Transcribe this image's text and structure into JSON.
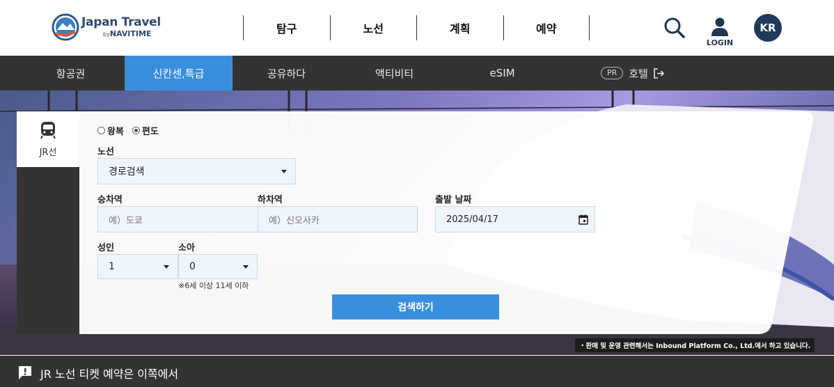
{
  "header": {
    "logo": {
      "title": "Japan Travel",
      "sub_by": "by",
      "sub_brand": "NAVITIME"
    },
    "nav": [
      "탐구",
      "노선",
      "계획",
      "예약"
    ],
    "login_label": "LOGIN",
    "lang_label": "KR"
  },
  "subnav": {
    "items": [
      {
        "label": "항공권",
        "active": false
      },
      {
        "label": "신칸센,특급",
        "active": true
      },
      {
        "label": "공유하다",
        "active": false
      },
      {
        "label": "액티비티",
        "active": false
      },
      {
        "label": "eSIM",
        "active": false
      },
      {
        "label": "호텔",
        "badge": "PR",
        "external": true,
        "active": false
      }
    ],
    "active_color": "#3a8fdc"
  },
  "side_tab": {
    "label": "JR선",
    "icon": "train-icon"
  },
  "form": {
    "trip_type": {
      "options": [
        "왕복",
        "편도"
      ],
      "selected": "편도"
    },
    "route": {
      "label": "노선",
      "value": "경로검색"
    },
    "departure": {
      "label": "승차역",
      "placeholder": "예）도쿄"
    },
    "arrival": {
      "label": "하차역",
      "placeholder": "예）신오사카"
    },
    "date": {
      "label": "출발 날짜",
      "value": "2025/04/17"
    },
    "adults": {
      "label": "성인",
      "value": "1"
    },
    "children": {
      "label": "소아",
      "value": "0",
      "note": "※6세 이상 11세 이하"
    },
    "submit_label": "검색하기"
  },
  "disclaimer": "・판매 및 운영 관련해서는 Inbound Platform Co., Ltd.에서 하고 있습니다.",
  "notice": {
    "text": "JR 노선 티켓 예약은 이쪽에서"
  }
}
